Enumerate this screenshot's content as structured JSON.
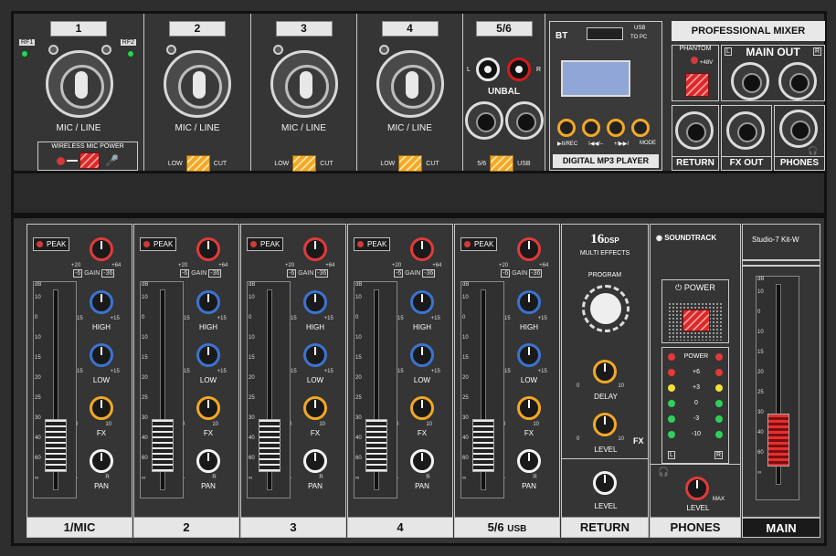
{
  "top": {
    "inputs": [
      {
        "num": "1",
        "label": "MIC / LINE",
        "rf1": "RF1",
        "rf2": "RF2",
        "wireless": "WIRELESS MIC POWER"
      },
      {
        "num": "2",
        "label": "MIC / LINE",
        "low": "LOW",
        "cut": "CUT"
      },
      {
        "num": "3",
        "label": "MIC / LINE",
        "low": "LOW",
        "cut": "CUT"
      },
      {
        "num": "4",
        "label": "MIC / LINE",
        "low": "LOW",
        "cut": "CUT"
      }
    ],
    "stereo": {
      "num": "5/6",
      "l": "L",
      "r": "R",
      "unbal": "UNBAL",
      "sel_a": "5/6",
      "sel_b": "USB"
    },
    "mp3": {
      "bt": "BT",
      "usb_label": "USB",
      "to_pc": "TO PC",
      "btns": [
        "▶II/REC",
        "I◀◀/–",
        "+/▶▶I",
        "MODE"
      ],
      "title": "DIGITAL MP3 PLAYER"
    },
    "brand_title": "PROFESSIONAL MIXER",
    "phantom": {
      "label": "PHANTOM",
      "volt": "+48V"
    },
    "main_out": {
      "label": "MAIN OUT",
      "l": "L",
      "r": "R"
    },
    "outs": [
      "RETURN",
      "FX OUT",
      "PHONES"
    ]
  },
  "strips": [
    {
      "name": "1/MIC"
    },
    {
      "name": "2"
    },
    {
      "name": "3"
    },
    {
      "name": "4"
    },
    {
      "name": "5/6",
      "sub": "USB"
    }
  ],
  "strip_labels": {
    "peak": "PEAK",
    "gain": "GAIN",
    "gain_min": "+20",
    "gain_max": "+64",
    "gain_b1": "-6",
    "gain_b2": "-36",
    "high": "HIGH",
    "low": "LOW",
    "fx": "FX",
    "pan": "PAN",
    "eq_min": "-15",
    "eq_max": "+15",
    "fx_min": "0",
    "fx_max": "10",
    "pan_l": "L",
    "pan_r": "R",
    "db": "dB"
  },
  "fader_scale": [
    "10",
    "0",
    "10",
    "15",
    "20",
    "25",
    "30",
    "40",
    "60",
    "∞"
  ],
  "effects": {
    "brand": "16",
    "dsp": "DSP",
    "title": "MULTI EFFECTS",
    "program": "PROGRAM",
    "delay": "DELAY",
    "level": "LEVEL",
    "fx": "FX",
    "min": "0",
    "max": "10",
    "return": "RETURN"
  },
  "master": {
    "brand": "SOUNDTRACK",
    "model": "Studio-7 Kit-W",
    "power": "POWER",
    "meter": [
      "POWER",
      "+6",
      "+3",
      "0",
      "-3",
      "-10"
    ],
    "l": "L",
    "r": "R",
    "phones_level": "LEVEL",
    "phones_max": "MAX",
    "phones": "PHONES",
    "main": "MAIN"
  },
  "colors": {
    "red": "#e23a3a",
    "blue": "#3b74d1",
    "orange": "#f3a827",
    "white": "#f4f4f4",
    "green": "#2fd05a",
    "yellow": "#f3e03a"
  }
}
